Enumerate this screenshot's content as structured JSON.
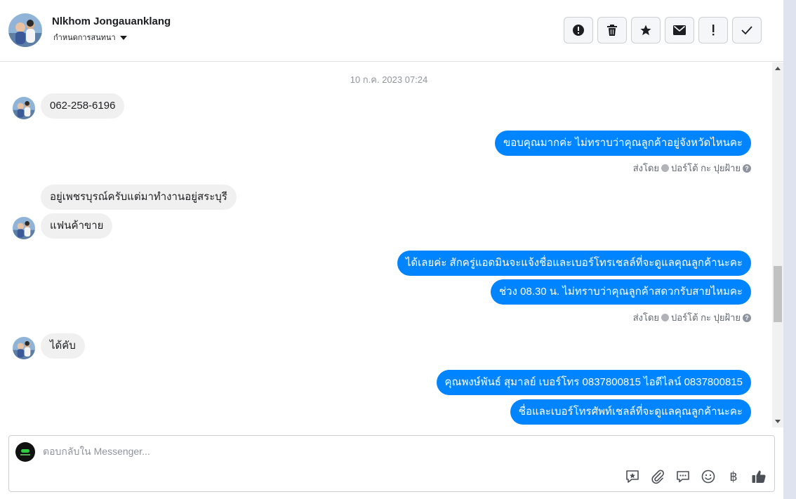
{
  "header": {
    "contact_name": "Nlkhom Jongauanklang",
    "assign_label": "กำหนดการสนทนา",
    "actions": [
      {
        "icon": "alert-circle-icon"
      },
      {
        "icon": "trash-icon"
      },
      {
        "icon": "star-icon"
      },
      {
        "icon": "envelope-icon"
      },
      {
        "icon": "exclamation-icon"
      },
      {
        "icon": "checkmark-icon"
      }
    ]
  },
  "chat": {
    "timestamp": "10 ก.ค. 2023 07:24",
    "messages": [
      {
        "dir": "in",
        "text": "062-258-6196"
      },
      {
        "dir": "out",
        "text": "ขอบคุณมากค่ะ ไม่ทราบว่าคุณลูกค้าอยู่จังหวัดไหนคะ"
      },
      {
        "dir": "in",
        "text": "อยู่เพชรบุรณ์ครับแต่มาทำงานอยู่สระบุรี"
      },
      {
        "dir": "in",
        "text": "แฟนค้าขาย"
      },
      {
        "dir": "out",
        "text": "ได้เลยค่ะ สักครู่แอดมินจะแจ้งชื่อและเบอร์โทรเชลล์ที่จะดูแลคุณลูกค้านะคะ"
      },
      {
        "dir": "out",
        "text": "ช่วง 08.30 น. ไม่ทราบว่าคุณลูกค้าสดวกรับสายไหมคะ"
      },
      {
        "dir": "in",
        "text": "ได้คับ"
      },
      {
        "dir": "out",
        "text": "คุณพงษ์พันธ์ สุมาลย์      เบอร์โทร 0837800815  ไอดีไลน์ 0837800815"
      },
      {
        "dir": "out",
        "text": "ชื่อและเบอร์โทรศัพท์เชลล์ที่จะดูแลคุณลูกค้านะคะ"
      }
    ],
    "sent_by_1": {
      "label": "ส่งโดย",
      "name": "ปอร์โต้ กะ ปุยฝ้าย"
    },
    "sent_by_2": {
      "label": "ส่งโดย",
      "name": "ปอร์โต้ กะ ปุยฝ้าย"
    }
  },
  "composer": {
    "placeholder": "ตอบกลับใน Messenger...",
    "tools": [
      "saved-reply-icon",
      "attachment-icon",
      "chat-bubble-icon",
      "emoji-icon",
      "baht-icon",
      "like-icon"
    ],
    "baht_symbol": "฿"
  },
  "colors": {
    "outgoing_bubble": "#0084ff",
    "incoming_bubble": "#f1f0f0"
  }
}
